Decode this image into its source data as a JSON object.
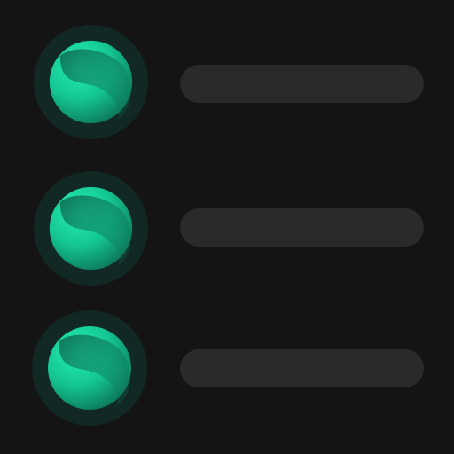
{
  "colors": {
    "background": "#141414",
    "ring": "#112824",
    "sphere_light": "#1ee3a8",
    "sphere_dark": "#0f6a52",
    "bar": "#2a2a2a"
  },
  "list": {
    "items": [
      {
        "icon": "gradient-sphere-icon",
        "label": ""
      },
      {
        "icon": "gradient-sphere-icon",
        "label": ""
      },
      {
        "icon": "gradient-sphere-icon",
        "label": ""
      }
    ]
  }
}
